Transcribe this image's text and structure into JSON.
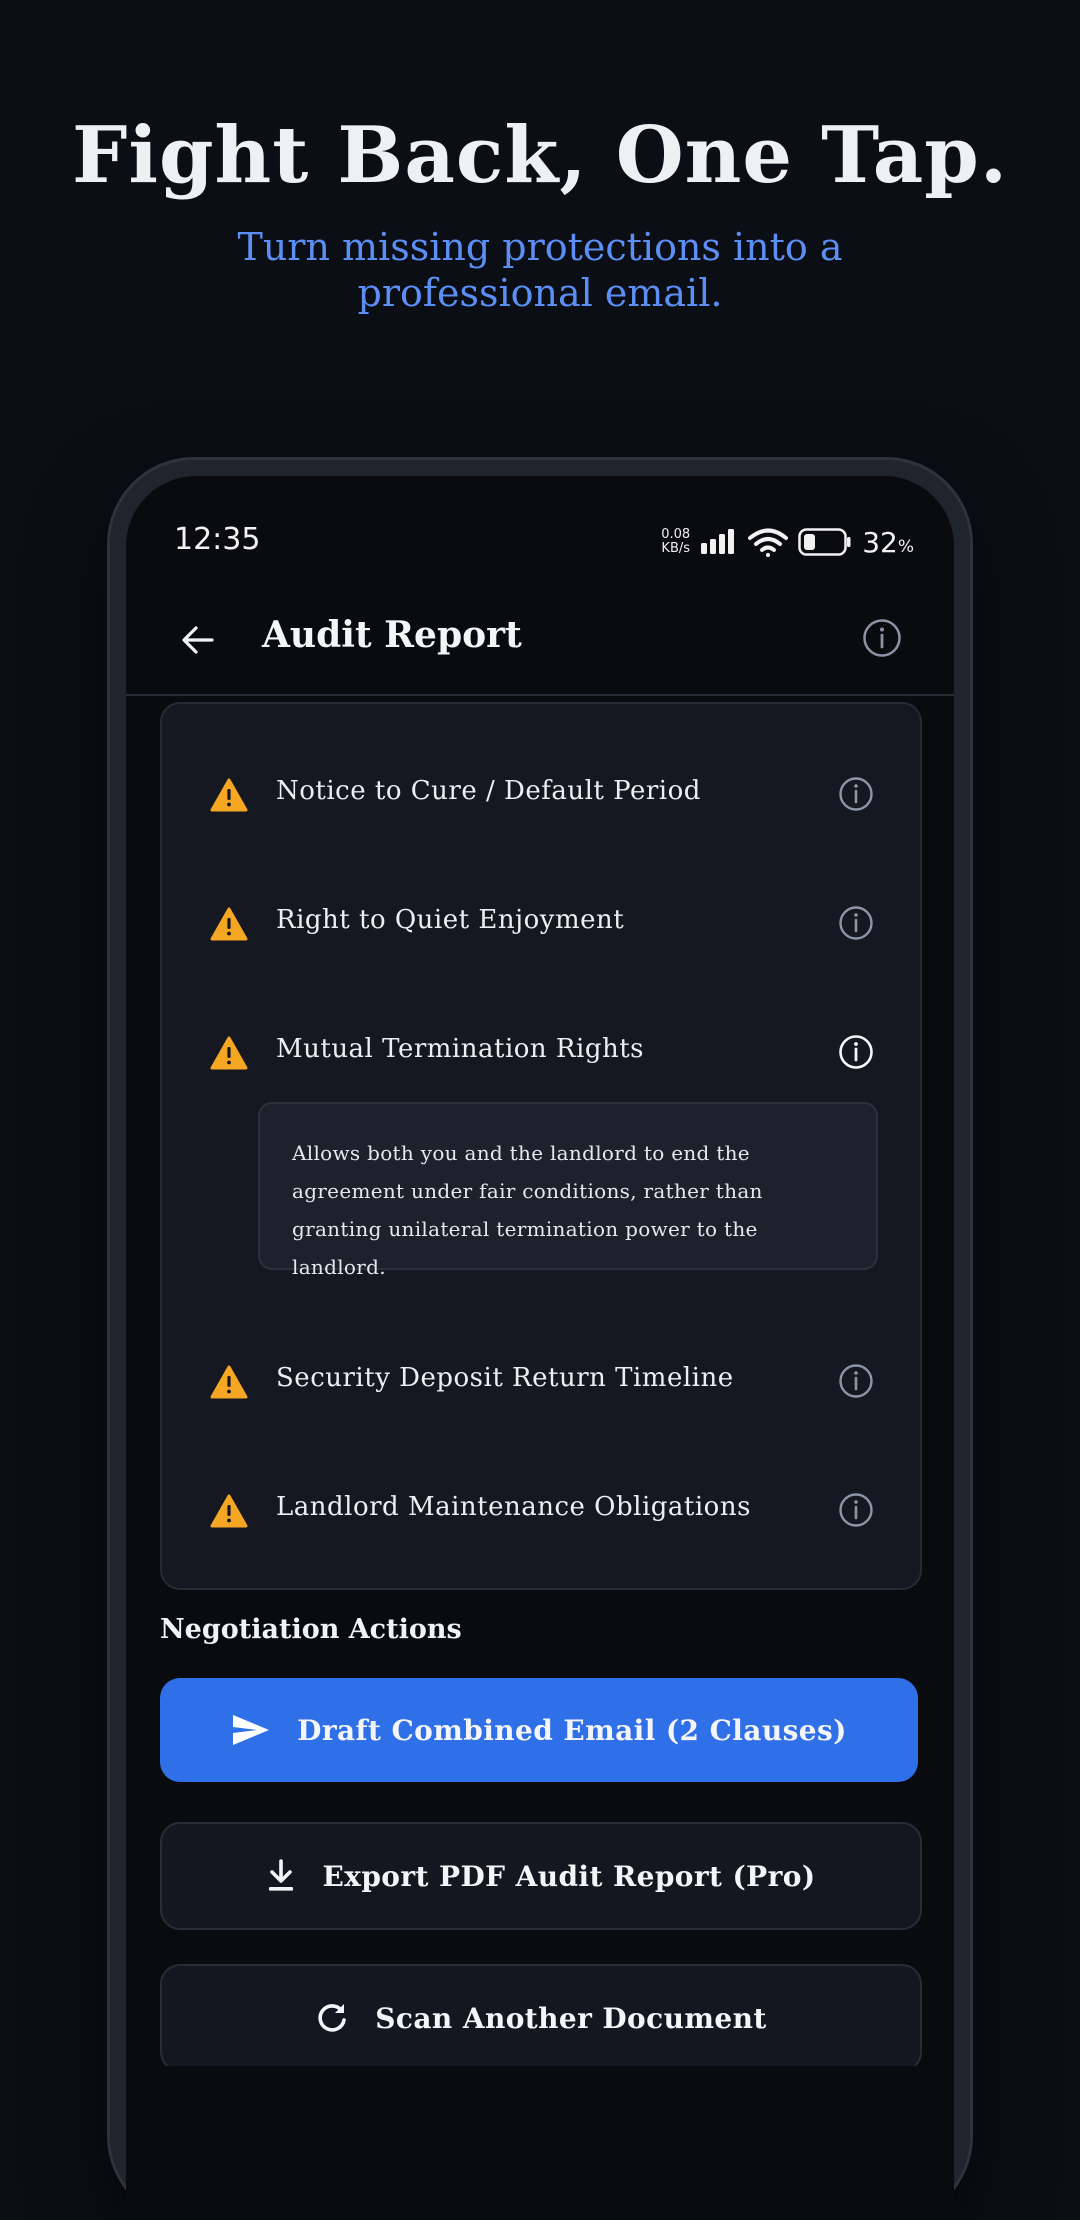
{
  "hero": {
    "title": "Fight Back, One Tap.",
    "subtitle": "Turn missing protections into a professional email."
  },
  "status_bar": {
    "time": "12:35",
    "net_speed_value": "0.08",
    "net_speed_unit": "KB/s",
    "battery_percent": "32",
    "battery_unit": "%"
  },
  "appbar": {
    "title": "Audit Report"
  },
  "clauses": [
    {
      "label": "Notice to Cure / Default Period"
    },
    {
      "label": "Right to Quiet Enjoyment"
    },
    {
      "label": "Mutual Termination Rights"
    },
    {
      "label": "Security Deposit Return Timeline"
    },
    {
      "label": "Landlord Maintenance Obligations"
    }
  ],
  "tooltip": {
    "text": "Allows both you and the landlord to end the agreement under fair conditions, rather than granting unilateral termination power to the landlord."
  },
  "actions": {
    "heading": "Negotiation Actions",
    "draft_email": "Draft Combined Email (2 Clauses)",
    "export_pdf": "Export PDF Audit Report (Pro)",
    "scan_another": "Scan Another Document"
  },
  "colors": {
    "accent": "#2f6fe8",
    "subtitle": "#5b8ff5",
    "warning": "#f5a623",
    "background": "#0b0e15"
  },
  "icons": [
    "back-arrow-icon",
    "info-icon",
    "warning-icon",
    "send-icon",
    "download-icon",
    "refresh-icon",
    "signal-icon",
    "wifi-icon",
    "battery-icon"
  ]
}
